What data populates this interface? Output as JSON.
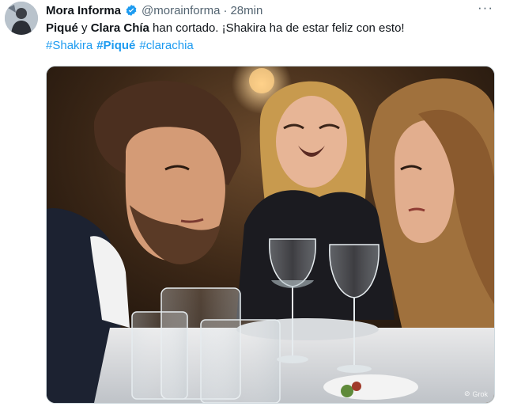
{
  "tweet": {
    "author_name": "Mora Informa",
    "handle": "@morainforma",
    "separator": "·",
    "time": "28min",
    "more_icon": "more-horizontal-icon",
    "text_bold_1": "Piqué",
    "text_mid": " y ",
    "text_bold_2": "Clara Chía",
    "text_rest": " han cortado. ¡Shakira ha de estar feliz con esto!",
    "hashtags": [
      "#Shakira",
      "#Piqué",
      "#clarachia"
    ],
    "watermark": "Grok",
    "colors": {
      "link": "#1d9bf0",
      "verified": "#1d9bf0",
      "muted": "#536471"
    }
  }
}
